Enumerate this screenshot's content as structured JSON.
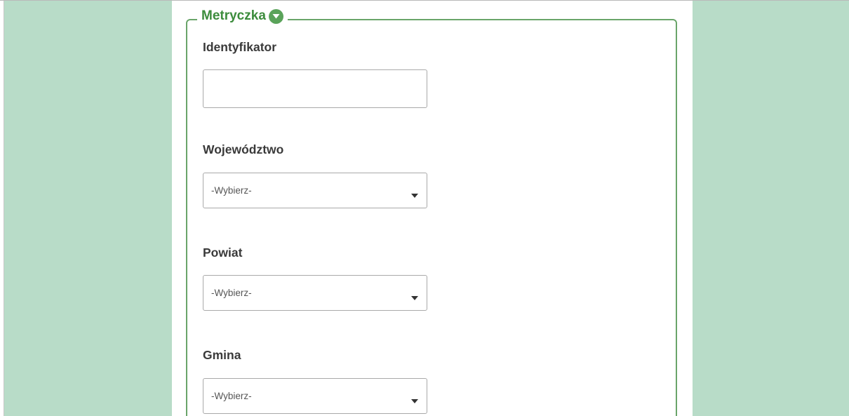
{
  "section": {
    "title": "Metryczka",
    "toggle_icon": "chevron-down-circle-icon"
  },
  "fields": {
    "identyfikator": {
      "label": "Identyfikator",
      "value": "",
      "placeholder": ""
    },
    "wojewodztwo": {
      "label": "Województwo",
      "selected": "-Wybierz-"
    },
    "powiat": {
      "label": "Powiat",
      "selected": "-Wybierz-"
    },
    "gmina": {
      "label": "Gmina",
      "selected": "-Wybierz-"
    }
  },
  "colors": {
    "background": "#b8dcc8",
    "accent": "#3c8c3c",
    "border": "#6aa56a"
  }
}
